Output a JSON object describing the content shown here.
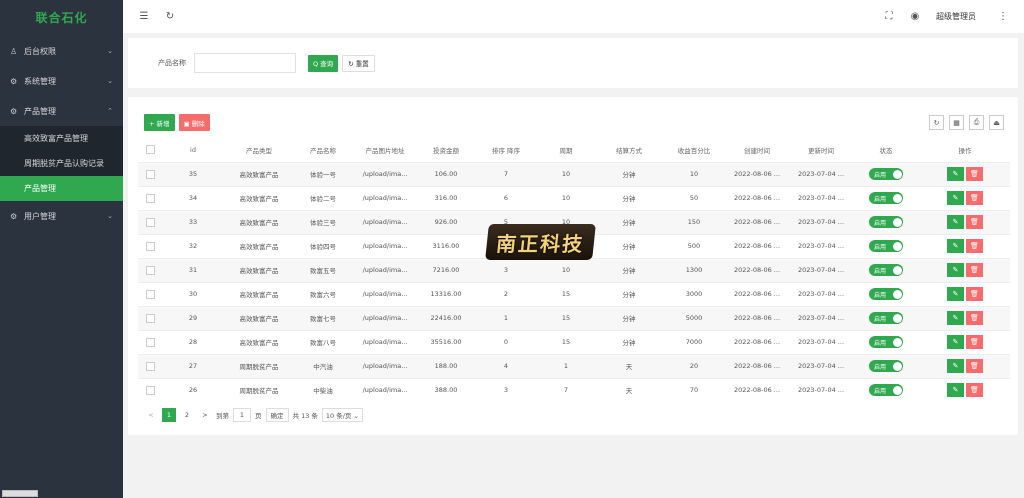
{
  "sidebar": {
    "brand": "联合石化",
    "groups": [
      {
        "icon": "user-icon",
        "glyph": "♙",
        "label": "后台权限",
        "chevron": "⌄"
      },
      {
        "icon": "gear-icon",
        "glyph": "⚙",
        "label": "系统管理",
        "chevron": "⌄"
      },
      {
        "icon": "gear-icon",
        "glyph": "⚙",
        "label": "产品管理",
        "chevron": "⌃"
      },
      {
        "icon": "gear-icon",
        "glyph": "⚙",
        "label": "用户管理",
        "chevron": "⌄"
      }
    ],
    "sub_items": [
      {
        "label": "高效致富产品管理"
      },
      {
        "label": "周期脱贫产品认购记录"
      },
      {
        "label": "产品管理"
      }
    ]
  },
  "header": {
    "menu_icon": "☰",
    "refresh_icon": "↻",
    "fullscreen_icon": "⛶",
    "globe_icon": "◉",
    "user": "超级管理员",
    "more_icon": "⋮"
  },
  "search": {
    "label": "产品名称",
    "input_value": "",
    "search_button": "Q 查询",
    "reset_button": "↻ 重置"
  },
  "toolbar": {
    "add_button": "+ 新增",
    "delete_button": "▣ 删除",
    "tool_icons": [
      "↻",
      "▦",
      "⎙",
      "⏏"
    ]
  },
  "table": {
    "headers": [
      "id",
      "产品类型",
      "产品名称",
      "产品图片地址",
      "投资金额",
      "排序 降序",
      "周期",
      "结算方式",
      "收益百分比",
      "创建时间",
      "更新时间",
      "状态",
      "操作"
    ],
    "rows": [
      {
        "id": "35",
        "type": "高效致富产品",
        "name": "体验一号",
        "img": "/upload/ima...",
        "amount": "106.00",
        "sort": "7",
        "cycle": "10",
        "settle": "分钟",
        "rate": "10",
        "created": "2022-08-06 ...",
        "updated": "2023-07-04 ...",
        "status": "启用"
      },
      {
        "id": "34",
        "type": "高效致富产品",
        "name": "体验二号",
        "img": "/upload/ima...",
        "amount": "316.00",
        "sort": "6",
        "cycle": "10",
        "settle": "分钟",
        "rate": "50",
        "created": "2022-08-06 ...",
        "updated": "2023-07-04 ...",
        "status": "启用"
      },
      {
        "id": "33",
        "type": "高效致富产品",
        "name": "体验三号",
        "img": "/upload/ima...",
        "amount": "926.00",
        "sort": "5",
        "cycle": "10",
        "settle": "分钟",
        "rate": "150",
        "created": "2022-08-06 ...",
        "updated": "2023-07-04 ...",
        "status": "启用"
      },
      {
        "id": "32",
        "type": "高效致富产品",
        "name": "体验四号",
        "img": "/upload/ima...",
        "amount": "3116.00",
        "sort": "4",
        "cycle": "10",
        "settle": "分钟",
        "rate": "500",
        "created": "2022-08-06 ...",
        "updated": "2023-07-04 ...",
        "status": "启用"
      },
      {
        "id": "31",
        "type": "高效致富产品",
        "name": "致富五号",
        "img": "/upload/ima...",
        "amount": "7216.00",
        "sort": "3",
        "cycle": "10",
        "settle": "分钟",
        "rate": "1300",
        "created": "2022-08-06 ...",
        "updated": "2023-07-04 ...",
        "status": "启用"
      },
      {
        "id": "30",
        "type": "高效致富产品",
        "name": "致富六号",
        "img": "/upload/ima...",
        "amount": "13316.00",
        "sort": "2",
        "cycle": "15",
        "settle": "分钟",
        "rate": "3000",
        "created": "2022-08-06 ...",
        "updated": "2023-07-04 ...",
        "status": "启用"
      },
      {
        "id": "29",
        "type": "高效致富产品",
        "name": "致富七号",
        "img": "/upload/ima...",
        "amount": "22416.00",
        "sort": "1",
        "cycle": "15",
        "settle": "分钟",
        "rate": "5000",
        "created": "2022-08-06 ...",
        "updated": "2023-07-04 ...",
        "status": "启用"
      },
      {
        "id": "28",
        "type": "高效致富产品",
        "name": "致富八号",
        "img": "/upload/ima...",
        "amount": "35516.00",
        "sort": "0",
        "cycle": "15",
        "settle": "分钟",
        "rate": "7000",
        "created": "2022-08-06 ...",
        "updated": "2023-07-04 ...",
        "status": "启用"
      },
      {
        "id": "27",
        "type": "周期脱贫产品",
        "name": "中汽油",
        "img": "/upload/ima...",
        "amount": "188.00",
        "sort": "4",
        "cycle": "1",
        "settle": "天",
        "rate": "20",
        "created": "2022-08-06 ...",
        "updated": "2023-07-04 ...",
        "status": "启用"
      },
      {
        "id": "26",
        "type": "周期脱贫产品",
        "name": "中柴油",
        "img": "/upload/ima...",
        "amount": "388.00",
        "sort": "3",
        "cycle": "7",
        "settle": "天",
        "rate": "70",
        "created": "2022-08-06 ...",
        "updated": "2023-07-04 ...",
        "status": "启用"
      }
    ],
    "edit_glyph": "✎",
    "delete_glyph": "🗑"
  },
  "pager": {
    "prev": "<",
    "pages": [
      "1",
      "2"
    ],
    "next": ">",
    "goto_label": "到第",
    "goto_value": "1",
    "page_suffix": "页",
    "confirm": "确定",
    "total": "共 13 条",
    "page_size": "10 条/页 ⌄"
  },
  "watermark": "南正科技"
}
